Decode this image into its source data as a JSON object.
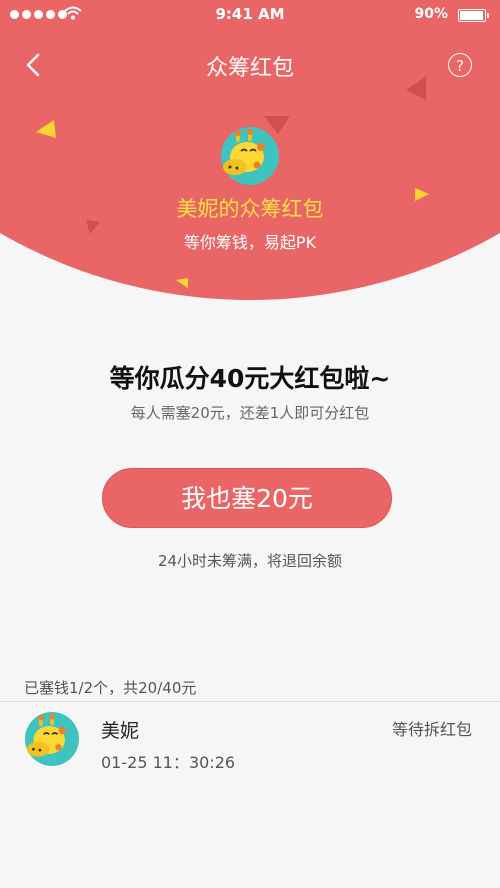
{
  "status_bar": {
    "time": "9:41 AM",
    "battery": "90%"
  },
  "nav": {
    "title": "众筹红包",
    "help_symbol": "?"
  },
  "host": {
    "name": "美妮的众筹红包",
    "slogan": "等你筹钱，易起PK"
  },
  "main": {
    "headline": "等你瓜分40元大红包啦~",
    "subline": "每人需塞20元，还差1人即可分红包",
    "join_button": "我也塞20元",
    "refund_note": "24小时未筹满，将退回余额"
  },
  "participants": {
    "progress_text": "已塞钱1/2个，共20/40元",
    "rows": [
      {
        "name": "美妮",
        "time": "01-25 11：30:26",
        "status": "等待拆红包"
      }
    ]
  },
  "colors": {
    "accent": "#e96566",
    "gold": "#fde045"
  }
}
